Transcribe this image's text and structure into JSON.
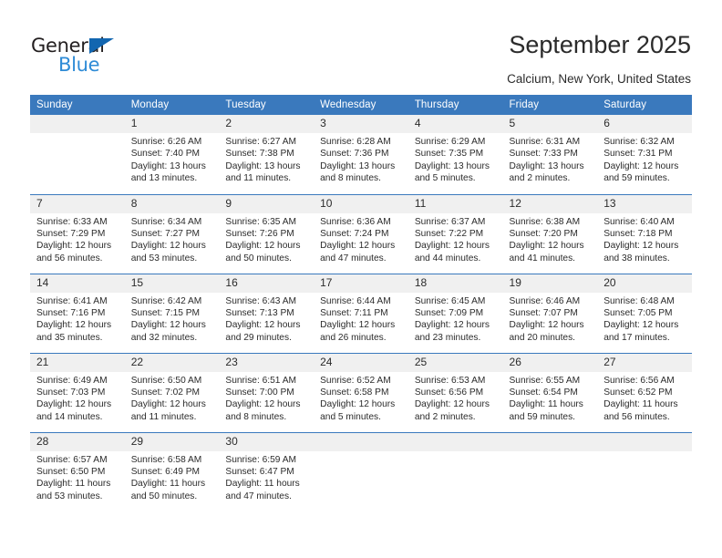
{
  "logo": {
    "word_dark": "General",
    "word_blue": "Blue",
    "triangle_color": "#1266b0",
    "blue_color": "#2e8bd6"
  },
  "header": {
    "title": "September 2025",
    "subtitle": "Calcium, New York, United States"
  },
  "theme": {
    "header_bar": "#3a79bd",
    "daynum_bg": "#f0f0f0",
    "text": "#2b2b2b"
  },
  "weekdays": [
    "Sunday",
    "Monday",
    "Tuesday",
    "Wednesday",
    "Thursday",
    "Friday",
    "Saturday"
  ],
  "weeks": [
    [
      {
        "day": "",
        "sunrise": "",
        "sunset": "",
        "daylight1": "",
        "daylight2": ""
      },
      {
        "day": "1",
        "sunrise": "Sunrise: 6:26 AM",
        "sunset": "Sunset: 7:40 PM",
        "daylight1": "Daylight: 13 hours",
        "daylight2": "and 13 minutes."
      },
      {
        "day": "2",
        "sunrise": "Sunrise: 6:27 AM",
        "sunset": "Sunset: 7:38 PM",
        "daylight1": "Daylight: 13 hours",
        "daylight2": "and 11 minutes."
      },
      {
        "day": "3",
        "sunrise": "Sunrise: 6:28 AM",
        "sunset": "Sunset: 7:36 PM",
        "daylight1": "Daylight: 13 hours",
        "daylight2": "and 8 minutes."
      },
      {
        "day": "4",
        "sunrise": "Sunrise: 6:29 AM",
        "sunset": "Sunset: 7:35 PM",
        "daylight1": "Daylight: 13 hours",
        "daylight2": "and 5 minutes."
      },
      {
        "day": "5",
        "sunrise": "Sunrise: 6:31 AM",
        "sunset": "Sunset: 7:33 PM",
        "daylight1": "Daylight: 13 hours",
        "daylight2": "and 2 minutes."
      },
      {
        "day": "6",
        "sunrise": "Sunrise: 6:32 AM",
        "sunset": "Sunset: 7:31 PM",
        "daylight1": "Daylight: 12 hours",
        "daylight2": "and 59 minutes."
      }
    ],
    [
      {
        "day": "7",
        "sunrise": "Sunrise: 6:33 AM",
        "sunset": "Sunset: 7:29 PM",
        "daylight1": "Daylight: 12 hours",
        "daylight2": "and 56 minutes."
      },
      {
        "day": "8",
        "sunrise": "Sunrise: 6:34 AM",
        "sunset": "Sunset: 7:27 PM",
        "daylight1": "Daylight: 12 hours",
        "daylight2": "and 53 minutes."
      },
      {
        "day": "9",
        "sunrise": "Sunrise: 6:35 AM",
        "sunset": "Sunset: 7:26 PM",
        "daylight1": "Daylight: 12 hours",
        "daylight2": "and 50 minutes."
      },
      {
        "day": "10",
        "sunrise": "Sunrise: 6:36 AM",
        "sunset": "Sunset: 7:24 PM",
        "daylight1": "Daylight: 12 hours",
        "daylight2": "and 47 minutes."
      },
      {
        "day": "11",
        "sunrise": "Sunrise: 6:37 AM",
        "sunset": "Sunset: 7:22 PM",
        "daylight1": "Daylight: 12 hours",
        "daylight2": "and 44 minutes."
      },
      {
        "day": "12",
        "sunrise": "Sunrise: 6:38 AM",
        "sunset": "Sunset: 7:20 PM",
        "daylight1": "Daylight: 12 hours",
        "daylight2": "and 41 minutes."
      },
      {
        "day": "13",
        "sunrise": "Sunrise: 6:40 AM",
        "sunset": "Sunset: 7:18 PM",
        "daylight1": "Daylight: 12 hours",
        "daylight2": "and 38 minutes."
      }
    ],
    [
      {
        "day": "14",
        "sunrise": "Sunrise: 6:41 AM",
        "sunset": "Sunset: 7:16 PM",
        "daylight1": "Daylight: 12 hours",
        "daylight2": "and 35 minutes."
      },
      {
        "day": "15",
        "sunrise": "Sunrise: 6:42 AM",
        "sunset": "Sunset: 7:15 PM",
        "daylight1": "Daylight: 12 hours",
        "daylight2": "and 32 minutes."
      },
      {
        "day": "16",
        "sunrise": "Sunrise: 6:43 AM",
        "sunset": "Sunset: 7:13 PM",
        "daylight1": "Daylight: 12 hours",
        "daylight2": "and 29 minutes."
      },
      {
        "day": "17",
        "sunrise": "Sunrise: 6:44 AM",
        "sunset": "Sunset: 7:11 PM",
        "daylight1": "Daylight: 12 hours",
        "daylight2": "and 26 minutes."
      },
      {
        "day": "18",
        "sunrise": "Sunrise: 6:45 AM",
        "sunset": "Sunset: 7:09 PM",
        "daylight1": "Daylight: 12 hours",
        "daylight2": "and 23 minutes."
      },
      {
        "day": "19",
        "sunrise": "Sunrise: 6:46 AM",
        "sunset": "Sunset: 7:07 PM",
        "daylight1": "Daylight: 12 hours",
        "daylight2": "and 20 minutes."
      },
      {
        "day": "20",
        "sunrise": "Sunrise: 6:48 AM",
        "sunset": "Sunset: 7:05 PM",
        "daylight1": "Daylight: 12 hours",
        "daylight2": "and 17 minutes."
      }
    ],
    [
      {
        "day": "21",
        "sunrise": "Sunrise: 6:49 AM",
        "sunset": "Sunset: 7:03 PM",
        "daylight1": "Daylight: 12 hours",
        "daylight2": "and 14 minutes."
      },
      {
        "day": "22",
        "sunrise": "Sunrise: 6:50 AM",
        "sunset": "Sunset: 7:02 PM",
        "daylight1": "Daylight: 12 hours",
        "daylight2": "and 11 minutes."
      },
      {
        "day": "23",
        "sunrise": "Sunrise: 6:51 AM",
        "sunset": "Sunset: 7:00 PM",
        "daylight1": "Daylight: 12 hours",
        "daylight2": "and 8 minutes."
      },
      {
        "day": "24",
        "sunrise": "Sunrise: 6:52 AM",
        "sunset": "Sunset: 6:58 PM",
        "daylight1": "Daylight: 12 hours",
        "daylight2": "and 5 minutes."
      },
      {
        "day": "25",
        "sunrise": "Sunrise: 6:53 AM",
        "sunset": "Sunset: 6:56 PM",
        "daylight1": "Daylight: 12 hours",
        "daylight2": "and 2 minutes."
      },
      {
        "day": "26",
        "sunrise": "Sunrise: 6:55 AM",
        "sunset": "Sunset: 6:54 PM",
        "daylight1": "Daylight: 11 hours",
        "daylight2": "and 59 minutes."
      },
      {
        "day": "27",
        "sunrise": "Sunrise: 6:56 AM",
        "sunset": "Sunset: 6:52 PM",
        "daylight1": "Daylight: 11 hours",
        "daylight2": "and 56 minutes."
      }
    ],
    [
      {
        "day": "28",
        "sunrise": "Sunrise: 6:57 AM",
        "sunset": "Sunset: 6:50 PM",
        "daylight1": "Daylight: 11 hours",
        "daylight2": "and 53 minutes."
      },
      {
        "day": "29",
        "sunrise": "Sunrise: 6:58 AM",
        "sunset": "Sunset: 6:49 PM",
        "daylight1": "Daylight: 11 hours",
        "daylight2": "and 50 minutes."
      },
      {
        "day": "30",
        "sunrise": "Sunrise: 6:59 AM",
        "sunset": "Sunset: 6:47 PM",
        "daylight1": "Daylight: 11 hours",
        "daylight2": "and 47 minutes."
      },
      {
        "day": "",
        "sunrise": "",
        "sunset": "",
        "daylight1": "",
        "daylight2": ""
      },
      {
        "day": "",
        "sunrise": "",
        "sunset": "",
        "daylight1": "",
        "daylight2": ""
      },
      {
        "day": "",
        "sunrise": "",
        "sunset": "",
        "daylight1": "",
        "daylight2": ""
      },
      {
        "day": "",
        "sunrise": "",
        "sunset": "",
        "daylight1": "",
        "daylight2": ""
      }
    ]
  ]
}
